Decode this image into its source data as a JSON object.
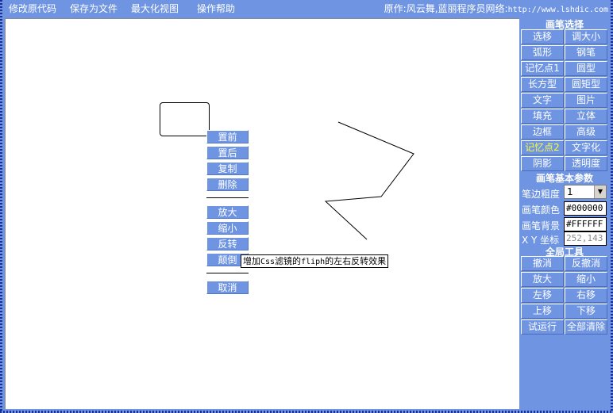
{
  "menu": {
    "items": [
      "修改原代码",
      "保存为文件",
      "最大化视图",
      "操作帮助"
    ],
    "credit": "原作:风云舞,蓝丽程序员网络:",
    "credit_url": "http://www.lshdic.com"
  },
  "context_menu": {
    "items": [
      "置前",
      "置后",
      "复制",
      "删除",
      "放大",
      "缩小",
      "反转",
      "颠倒",
      "取消"
    ]
  },
  "tooltip": {
    "pre": "增加",
    "css": "Css",
    "mid": "滤镜的",
    "fliph": "fliph",
    "post": "的左右反转效果"
  },
  "panel": {
    "brush_title": "画笔选择",
    "brush_buttons": [
      "选移",
      "调大小",
      "弧形",
      "钢笔",
      "记忆点1",
      "圆型",
      "长方型",
      "圆矩型",
      "文字",
      "图片",
      "填充",
      "立体",
      "边框",
      "高级",
      "记忆点2",
      "文字化",
      "阴影",
      "透明度"
    ],
    "active_button": "记忆点2",
    "params_title": "画笔基本参数",
    "border_width_label": "笔边粗度",
    "border_width_value": "1",
    "color_label": "画笔颜色",
    "color_value": "#000000",
    "bg_label": "画笔背景",
    "bg_value": "#FFFFFF",
    "xy_label": "X Y 坐标",
    "xy_value": "252,143",
    "tools_title": "全局工具",
    "tool_buttons": [
      "撤消",
      "反撤消",
      "放大",
      "缩小",
      "左移",
      "右移",
      "上移",
      "下移",
      "试运行",
      "全部清除"
    ]
  },
  "colors": {
    "background": "#6f95e2",
    "canvas": "#ffffff",
    "active_text": "#ffff33",
    "frame": "#1a2f9a"
  }
}
